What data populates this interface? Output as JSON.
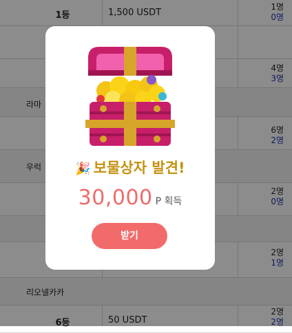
{
  "table": {
    "row1": {
      "rank": "1등",
      "prize": "1,500 USDT",
      "count_a": "1명",
      "count_b": "0명"
    },
    "row2": {
      "count_a": "4명",
      "count_b": "3명"
    },
    "section1": {
      "label": "라마"
    },
    "row3": {
      "count_a": "6명",
      "count_b": "2명"
    },
    "section2": {
      "label": "우럭"
    },
    "row4": {
      "count_a": "2명",
      "count_b": "0명"
    },
    "row5": {
      "count_a": "2명",
      "count_b": "1명"
    },
    "section3": {
      "label": "리오넬카카"
    },
    "row6": {
      "rank": "6등",
      "prize": "50 USDT",
      "count_a": "2명",
      "count_b": "2명"
    }
  },
  "modal": {
    "icon": "treasure-chest-icon",
    "party_icon": "🎉",
    "title": "보물상자 발견!",
    "amount": "30,000",
    "unit": "P 획득",
    "button": "받기"
  },
  "colors": {
    "title": "#c49212",
    "amount": "#ef6a6a",
    "button": "#f26b6b",
    "count_blue": "#1f2fa8"
  }
}
